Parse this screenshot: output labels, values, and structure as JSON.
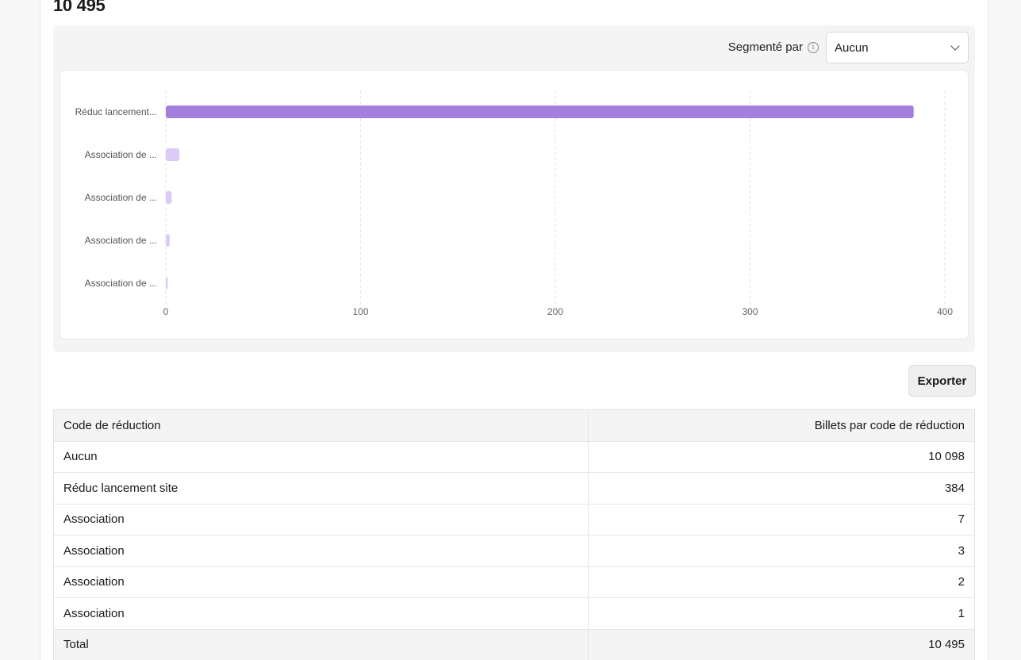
{
  "header": {
    "total": "10 495"
  },
  "filter": {
    "label": "Segmenté par",
    "selected": "Aucun"
  },
  "export_label": "Exporter",
  "chart_data": {
    "type": "bar",
    "orientation": "horizontal",
    "categories": [
      "Réduc lancement...",
      "Association de ...",
      "Association de ...",
      "Association de ...",
      "Association de ..."
    ],
    "values": [
      384,
      7,
      3,
      2,
      1
    ],
    "xlim": [
      0,
      400
    ],
    "xticks": [
      0,
      100,
      200,
      300,
      400
    ],
    "colors": [
      "#a57fde",
      "#dccbf6",
      "#dccbf6",
      "#dccbf6",
      "#dccbf6"
    ],
    "grid": true
  },
  "table": {
    "headers": [
      "Code de réduction",
      "Billets par code de réduction"
    ],
    "rows": [
      [
        "Aucun",
        "10 098"
      ],
      [
        "Réduc lancement site",
        "384"
      ],
      [
        "Association",
        "7"
      ],
      [
        "Association",
        "3"
      ],
      [
        "Association",
        "2"
      ],
      [
        "Association",
        "1"
      ]
    ],
    "total": [
      "Total",
      "10 495"
    ]
  }
}
